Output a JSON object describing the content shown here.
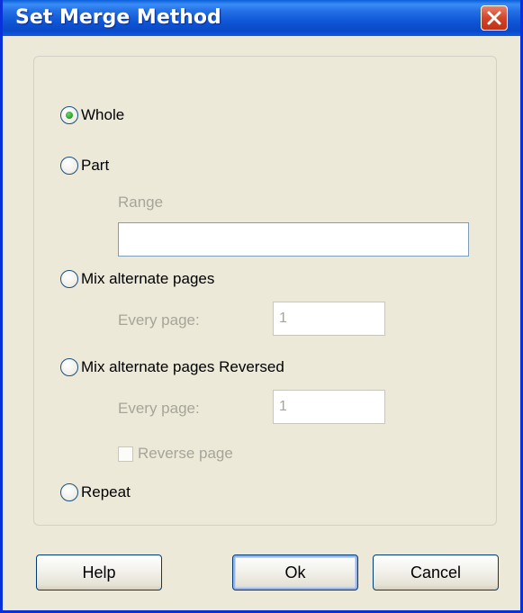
{
  "window": {
    "title": "Set Merge Method"
  },
  "options": {
    "whole": {
      "label": "Whole",
      "checked": true
    },
    "part": {
      "label": "Part",
      "checked": false,
      "range_label": "Range",
      "range_value": ""
    },
    "mix": {
      "label": "Mix alternate pages",
      "checked": false,
      "every_page_label": "Every page:",
      "every_page_value": "1"
    },
    "mix_reversed": {
      "label": "Mix alternate pages Reversed",
      "checked": false,
      "every_page_label": "Every page:",
      "every_page_value": "1",
      "reverse_page_label": "Reverse page",
      "reverse_page_checked": false
    },
    "repeat": {
      "label": "Repeat",
      "checked": false
    }
  },
  "buttons": {
    "help": "Help",
    "ok": "Ok",
    "cancel": "Cancel"
  },
  "icons": {
    "close": "close-icon"
  },
  "colors": {
    "title_bar": "#0a49c8",
    "close_button": "#d2452a",
    "dialog_bg": "#ece9d8"
  }
}
